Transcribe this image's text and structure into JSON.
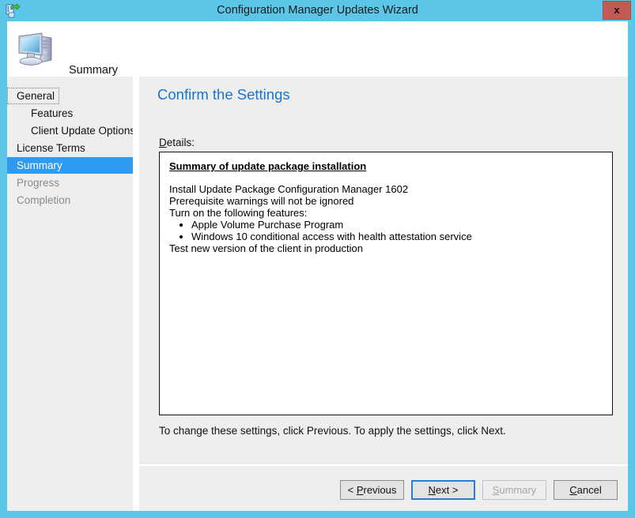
{
  "window": {
    "title": "Configuration Manager Updates Wizard",
    "title_icon": "update-package-icon",
    "close_label": "x",
    "frame_color": "#5cc6e8",
    "close_button_color": "#c15b53"
  },
  "banner": {
    "icon": "computer-monitor-icon",
    "title": "Summary"
  },
  "sidebar": {
    "items": [
      {
        "label": "General",
        "state": "normal",
        "indent": false,
        "focused": true
      },
      {
        "label": "Features",
        "state": "normal",
        "indent": true,
        "focused": false
      },
      {
        "label": "Client Update Options",
        "state": "normal",
        "indent": true,
        "focused": false
      },
      {
        "label": "License Terms",
        "state": "normal",
        "indent": false,
        "focused": false
      },
      {
        "label": "Summary",
        "state": "selected",
        "indent": false,
        "focused": false
      },
      {
        "label": "Progress",
        "state": "disabled",
        "indent": false,
        "focused": false
      },
      {
        "label": "Completion",
        "state": "disabled",
        "indent": false,
        "focused": false
      }
    ],
    "selected_bg": "#2e9bf0"
  },
  "content": {
    "heading": "Confirm the Settings",
    "heading_color": "#1675d1",
    "details_label_accel": "D",
    "details_label_rest": "etails:",
    "details": {
      "title": "Summary of update package installation",
      "lines": [
        "Install Update Package Configuration Manager 1602",
        "Prerequisite warnings will not be ignored",
        "Turn on the following features:"
      ],
      "bullets": [
        "Apple Volume Purchase Program",
        "Windows 10 conditional access with health attestation service"
      ],
      "trailing_lines": [
        "Test new version of the client in production"
      ]
    },
    "footer_note": "To change these settings, click Previous. To apply the settings, click Next."
  },
  "buttons": {
    "previous": {
      "pre": "< ",
      "accel": "P",
      "post": "revious",
      "state": "enabled"
    },
    "next": {
      "pre": "",
      "accel": "N",
      "post": "ext >",
      "state": "default"
    },
    "summary": {
      "pre": "",
      "accel": "S",
      "post": "ummary",
      "state": "disabled"
    },
    "cancel": {
      "pre": "",
      "accel": "C",
      "post": "ancel",
      "state": "enabled"
    }
  }
}
